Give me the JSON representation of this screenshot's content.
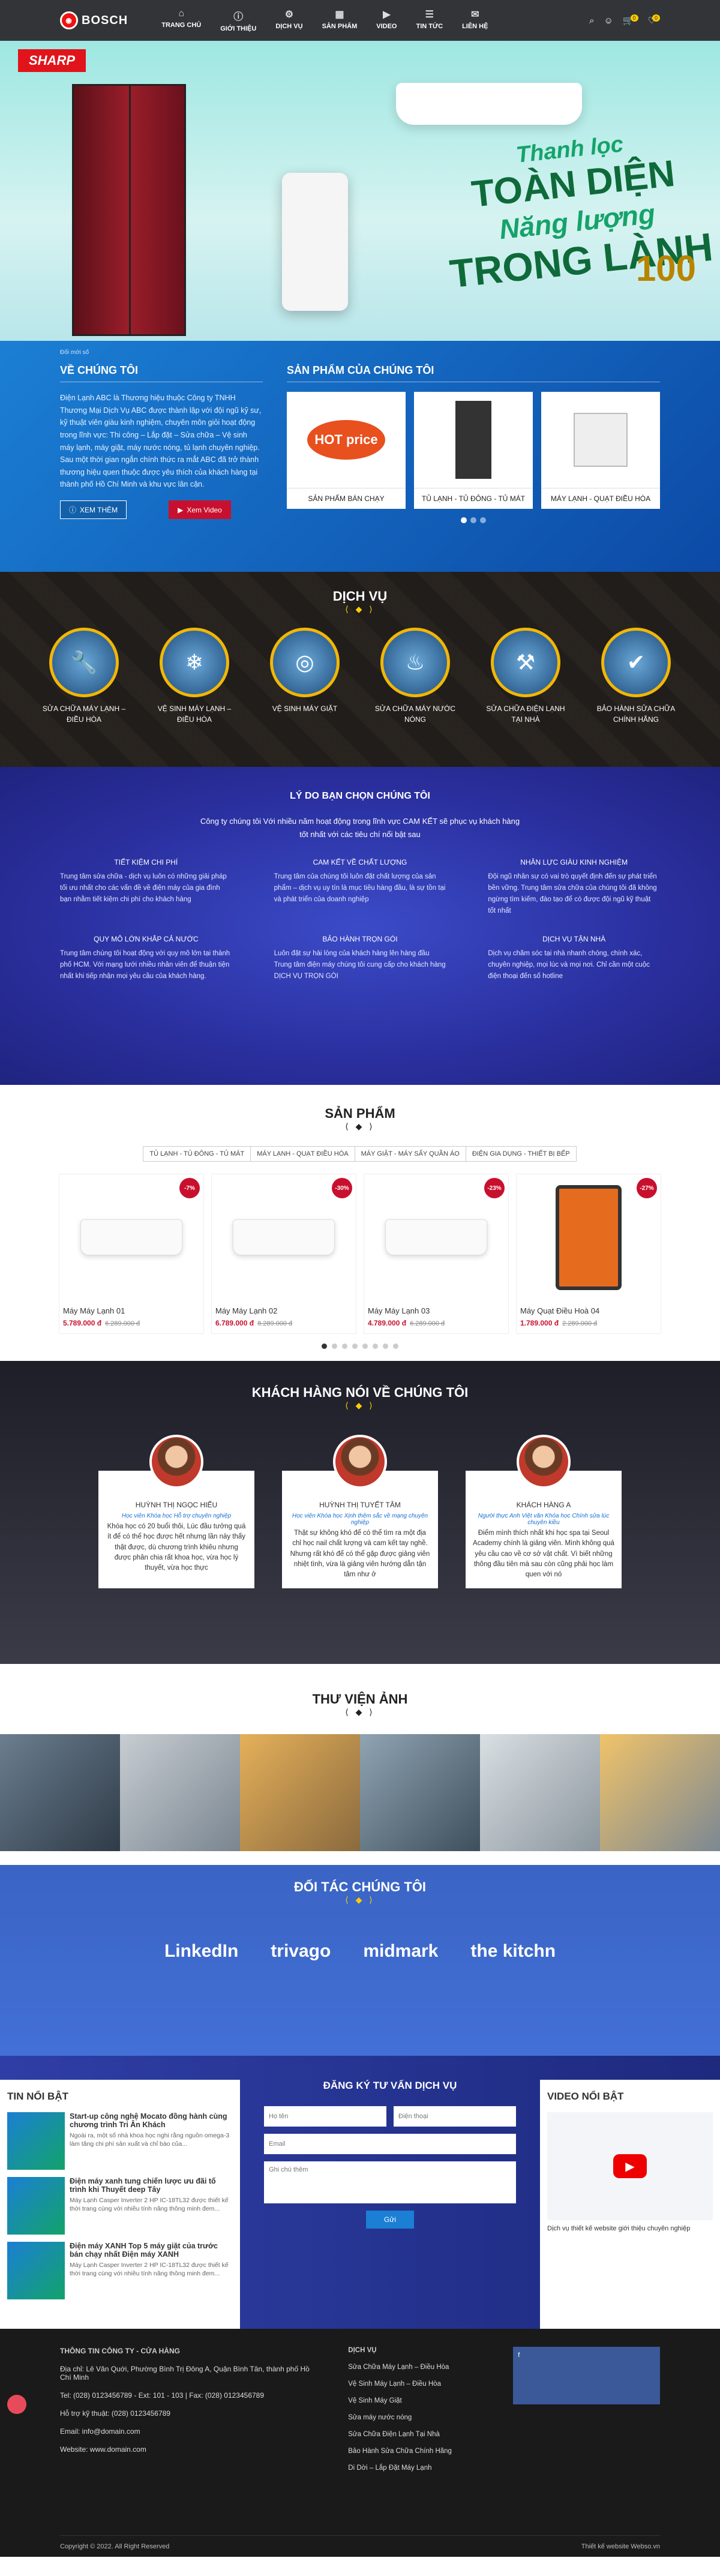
{
  "header": {
    "logo": "BOSCH",
    "nav": [
      "TRANG CHỦ",
      "GIỚI THIỆU",
      "DỊCH VỤ",
      "SẢN PHẨM",
      "VIDEO",
      "TIN TỨC",
      "LIÊN HỆ"
    ],
    "cart_count": "0",
    "wish_count": "0"
  },
  "hero": {
    "brand": "SHARP",
    "line1": "Thanh lọc",
    "line2": "TOÀN DIỆN",
    "line3": "Năng lượng",
    "line4": "TRONG LÀNH",
    "badge": "100"
  },
  "about": {
    "breadcrumb": "Đối mới số",
    "title": "VỀ CHÚNG TÔI",
    "text": "Điện Lạnh ABC là Thương hiệu thuộc Công ty TNHH Thương Mại Dịch Vụ ABC được thành lập với đội ngũ kỹ sư, kỹ thuật viên giàu kinh nghiệm, chuyên môn giỏi hoạt động trong lĩnh vực: Thi công – Lắp đặt – Sửa chữa – Vệ sinh máy lạnh, máy giặt, máy nước nóng, tủ lạnh chuyên nghiệp. Sau một thời gian ngắn chính thức ra mắt ABC đã trở thành thương hiệu quen thuộc được yêu thích của khách hàng tại thành phố Hồ Chí Minh và khu vực lân cận.",
    "btn_more": "XEM THÊM",
    "btn_video": "Xem Video",
    "products_title": "SẢN PHẨM CỦA CHÚNG TÔI",
    "cards": [
      {
        "label": "SẢN PHẨM BÁN CHẠY",
        "tag": "HOT price"
      },
      {
        "label": "TỦ LẠNH - TỦ ĐÔNG - TỦ MÁT"
      },
      {
        "label": "MÁY LẠNH - QUẠT ĐIỀU HÒA"
      }
    ]
  },
  "services": {
    "title": "DỊCH VỤ",
    "items": [
      "SỬA CHỮA MÁY LẠNH – ĐIỀU HÒA",
      "VỆ SINH MÁY LẠNH – ĐIỀU HÒA",
      "VỆ SINH MÁY GIẶT",
      "SỬA CHỮA MÁY NƯỚC NÓNG",
      "SỬA CHỮA ĐIỆN LẠNH TẠI NHÀ",
      "BẢO HÀNH SỬA CHỮA CHÍNH HÃNG"
    ]
  },
  "reasons": {
    "title": "LÝ DO BẠN CHỌN CHÚNG TÔI",
    "intro": "Công ty chúng tôi Với nhiều năm hoạt động trong lĩnh vực CAM KẾT sẽ phục vụ khách hàng tốt nhất với các tiêu chí nổi bật sau",
    "items": [
      {
        "h": "TIẾT KIỆM CHI PHÍ",
        "p": "Trung tâm sửa chữa - dịch vụ luôn có những giải pháp tối ưu nhất cho các vấn đề về điện máy của gia đình bạn nhằm tiết kiệm chi phí cho khách hàng"
      },
      {
        "h": "CAM KẾT VỀ CHẤT LƯỢNG",
        "p": "Trung tâm của chúng tôi luôn đặt chất lượng của sản phẩm – dịch vụ uy tín là mục tiêu hàng đầu, là sự tồn tại và phát triển của doanh nghiệp"
      },
      {
        "h": "NHÂN LỰC GIÀU KINH NGHIỆM",
        "p": "Đội ngũ nhân sự có vai trò quyết định đến sự phát triển bền vững. Trung tâm sửa chữa của chúng tôi đã không ngừng tìm kiếm, đào tạo để có được đội ngũ kỹ thuật tốt nhất"
      },
      {
        "h": "QUY MÔ LỚN KHẮP CẢ NƯỚC",
        "p": "Trung tâm chúng tôi hoạt động với quy mô lớn tại thành phố HCM. Với mạng lưới nhiều nhân viên để thuận tiện nhất khi tiếp nhận mọi yêu cầu của khách hàng."
      },
      {
        "h": "BẢO HÀNH TRỌN GÓI",
        "p": "Luôn đặt sự hài lòng của khách hàng lên hàng đầu Trung tâm điện máy chúng tôi cung cấp cho khách hàng DỊCH VỤ TRỌN GÓI"
      },
      {
        "h": "DỊCH VỤ TẬN NHÀ",
        "p": "Dịch vụ chăm sóc tại nhà nhanh chóng, chính xác, chuyên nghiệp, mọi lúc và mọi nơi. Chỉ cần một cuộc điện thoại đến số hotline"
      }
    ]
  },
  "products": {
    "title": "SẢN PHẨM",
    "tabs": [
      "TỦ LẠNH - TỦ ĐÔNG - TỦ MÁT",
      "MÁY LẠNH - QUẠT ĐIỀU HÒA",
      "MÁY GIẶT - MÁY SẤY QUẦN ÁO",
      "ĐIỆN GIA DỤNG - THIẾT BỊ BẾP"
    ],
    "items": [
      {
        "name": "Máy Máy Lạnh 01",
        "price": "5.789.000 đ",
        "old": "6.289.000 đ",
        "sale": "-7%"
      },
      {
        "name": "Máy Máy Lạnh 02",
        "price": "6.789.000 đ",
        "old": "8.289.000 đ",
        "sale": "-30%"
      },
      {
        "name": "Máy Máy Lạnh 03",
        "price": "4.789.000 đ",
        "old": "6.289.000 đ",
        "sale": "-23%"
      },
      {
        "name": "Máy Quạt Điều Hoà 04",
        "price": "1.789.000 đ",
        "old": "2.289.000 đ",
        "sale": "-27%"
      }
    ]
  },
  "testimonials": {
    "title": "KHÁCH HÀNG NÓI VỀ CHÚNG TÔI",
    "items": [
      {
        "name": "HUỲNH THỊ NGỌC HIẾU",
        "role": "Học viên Khóa học Hỗ trợ chuyên nghiệp",
        "quote": "Khóa học có 20 buổi thôi, Lúc đầu tưởng quá ít để có thể học được hết nhưng lần này thấy thật được, dù chương trình khiêu nhưng được phân chia rất khoa học, vừa học lý thuyết, vừa học thực"
      },
      {
        "name": "HUỲNH THỊ TUYẾT TÂM",
        "role": "Học viên Khóa học Xịnh thêm sắc về mạng chuyên nghiệp",
        "quote": "Thật sự không khó để có thể tìm ra một địa chỉ học nail chất lượng và cam kết tay nghề. Nhưng rất khó để có thể gặp được giảng viên nhiệt tình, vừa là giảng viên hướng dẫn tận tâm như ở"
      },
      {
        "name": "KHÁCH HÀNG A",
        "role": "Người thực Anh Việt văn Khóa học Chính sửa lúc chuyên kiều",
        "quote": "Điểm mình thích nhất khi học spa tại Seoul Academy chính là giảng viên. Mình không quá yêu cầu cao về cơ sở vật chất. Vì biết những thông đầu tiên mà sau còn cũng phải học làm quen với nó"
      }
    ]
  },
  "gallery": {
    "title": "THƯ VIỆN ẢNH"
  },
  "partners": {
    "title": "ĐỐI TÁC CHÚNG TÔI",
    "logos": [
      "LinkedIn",
      "trivago",
      "midmark",
      "the kitchn"
    ]
  },
  "news": {
    "title": "TIN NỔI BẬT",
    "items": [
      {
        "t": "Start-up công nghệ Mocato đồng hành cùng chương trình Tri Ân Khách",
        "x": "Ngoài ra, một số nhà khoa học nghi rằng nguồn omega-3 làm tăng chi phí sản xuất và chỉ bào của..."
      },
      {
        "t": "Điện máy xanh tung chiến lược ưu đãi tố trình khi Thuyết deep Tây",
        "x": "Máy Lạnh Casper Inverter 2 HP IC-18TL32 được thiết kế thời trang cùng với nhiều tính năng thông minh đem..."
      },
      {
        "t": "Điện máy XANH Top 5 máy giặt của trước bán chạy nhất Điện máy XANH",
        "x": "Máy Lạnh Casper Inverter 2 HP IC-18TL32 được thiết kế thời trang cùng với nhiều tính năng thông minh đem..."
      }
    ]
  },
  "form": {
    "title": "ĐĂNG KÝ TƯ VẤN DỊCH VỤ",
    "name": "Họ tên",
    "phone": "Điện thoại",
    "email": "Email",
    "note": "Ghi chú thêm",
    "submit": "Gửi"
  },
  "video": {
    "title": "VIDEO NỔI BẬT",
    "caption": "Dịch vụ thiết kế website giới thiệu chuyên nghiệp"
  },
  "footer": {
    "info_title": "THÔNG TIN CÔNG TY - CỬA HÀNG",
    "address": "Địa chỉ: Lê Văn Quới, Phường Bình Trị Đông A, Quận Bình Tân, thành phố Hồ Chí Minh",
    "tel": "Tel: (028) 0123456789 - Ext: 101 - 103 | Fax: (028) 0123456789",
    "hotline": "Hỗ trợ kỹ thuật: (028) 0123456789",
    "email": "Email: info@domain.com",
    "site": "Website: www.domain.com",
    "svc_title": "DỊCH VỤ",
    "links": [
      "Sửa Chữa Máy Lạnh – Điều Hòa",
      "Vệ Sinh Máy Lạnh – Điều Hòa",
      "Vệ Sinh Máy Giặt",
      "Sửa máy nước nóng",
      "Sửa Chữa Điện Lạnh Tại Nhà",
      "Bảo Hành Sửa Chữa Chính Hãng",
      "Di Dời – Lắp Đặt Máy Lạnh"
    ],
    "copyright": "Copyright © 2022. All Right Reserved",
    "credit": "Thiết kế website Webso.vn"
  },
  "colors": {
    "accent": "#1b7fd4",
    "brand_red": "#c8102e",
    "gold": "#f2b705"
  }
}
